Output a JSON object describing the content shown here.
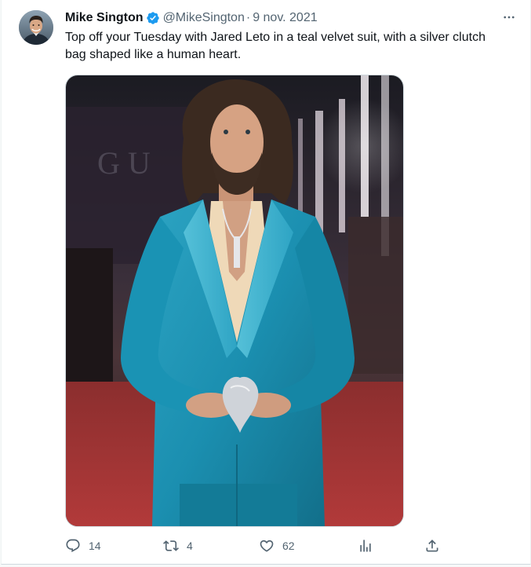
{
  "tweet": {
    "author_name": "Mike Sington",
    "handle": "@MikeSington",
    "separator": "·",
    "date": "9 nov. 2021",
    "text": "Top off your Tuesday with Jared Leto in a teal velvet suit, with a silver clutch bag shaped like a human heart.",
    "verified": true
  },
  "icons": {
    "verified": "verified-badge-icon",
    "more": "more-options-icon",
    "reply": "reply-icon",
    "retweet": "retweet-icon",
    "like": "like-icon",
    "views": "views-icon",
    "share": "share-icon"
  },
  "actions": {
    "reply_count": "14",
    "retweet_count": "4",
    "like_count": "62"
  },
  "colors": {
    "accent": "#1d9bf0",
    "secondary_text": "#536471",
    "primary_text": "#0f1419"
  }
}
